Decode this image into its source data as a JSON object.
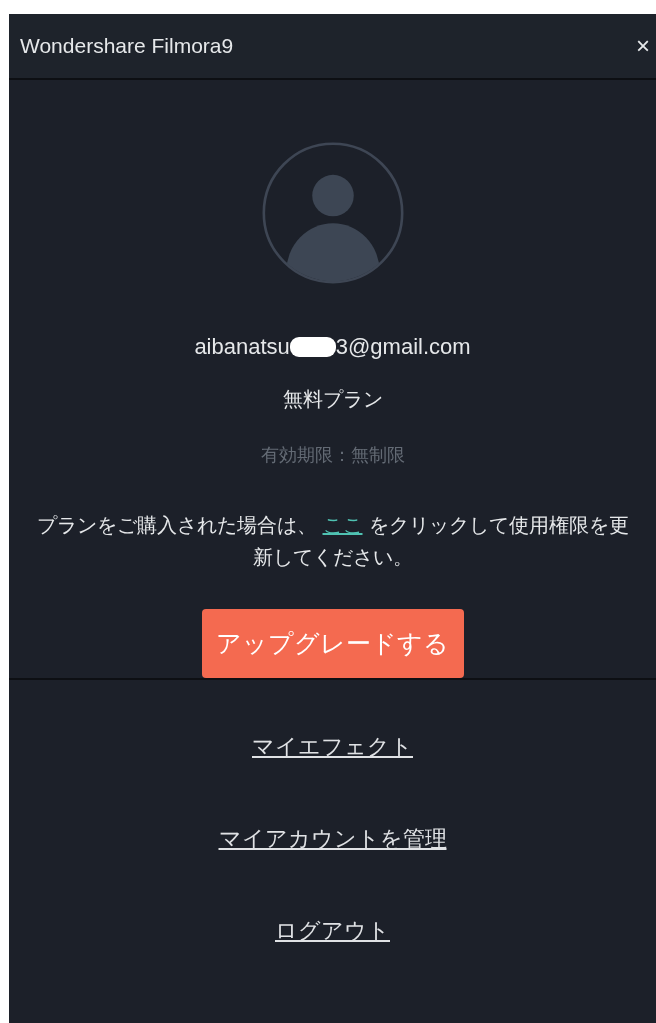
{
  "window": {
    "title": "Wondershare Filmora9",
    "close": "×"
  },
  "account": {
    "email_start": "aibanatsu",
    "email_end": "3@gmail.com",
    "plan": "無料プラン",
    "expiry": "有効期限：無制限"
  },
  "notice": {
    "before": "プランをご購入された場合は、",
    "link": "ここ",
    "after": "をクリックして使用権限を更新してください。"
  },
  "upgrade_button": "アップグレードする",
  "links": [
    "マイエフェクト",
    "マイアカウントを管理",
    "ログアウト"
  ]
}
